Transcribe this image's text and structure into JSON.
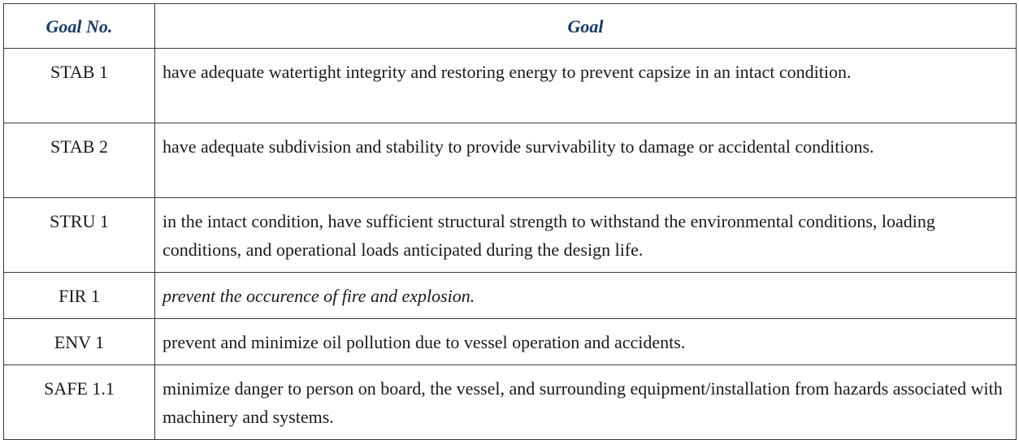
{
  "table": {
    "headers": {
      "goal_no": "Goal No.",
      "goal": "Goal"
    },
    "rows": [
      {
        "no": "STAB 1",
        "goal": "have adequate watertight integrity and restoring energy to prevent capsize in an intact condition."
      },
      {
        "no": "STAB 2",
        "goal": "have adequate subdivision and stability to provide survivability to damage or accidental conditions."
      },
      {
        "no": "STRU 1",
        "goal": "in the intact condition, have sufficient structural strength to withstand the environmental conditions, loading conditions, and operational loads anticipated during the design life."
      },
      {
        "no": "FIR 1",
        "goal": "prevent the occurence of fire and explosion."
      },
      {
        "no": "ENV 1",
        "goal": "prevent and minimize oil pollution due to vessel operation and accidents."
      },
      {
        "no": "SAFE 1.1",
        "goal": "minimize danger to person on board, the vessel, and surrounding equipment/installation from hazards associated with machinery and systems."
      }
    ]
  },
  "colors": {
    "header_text": "#163a66",
    "border": "#3a3a3a",
    "body_text": "#1a1a1a"
  }
}
